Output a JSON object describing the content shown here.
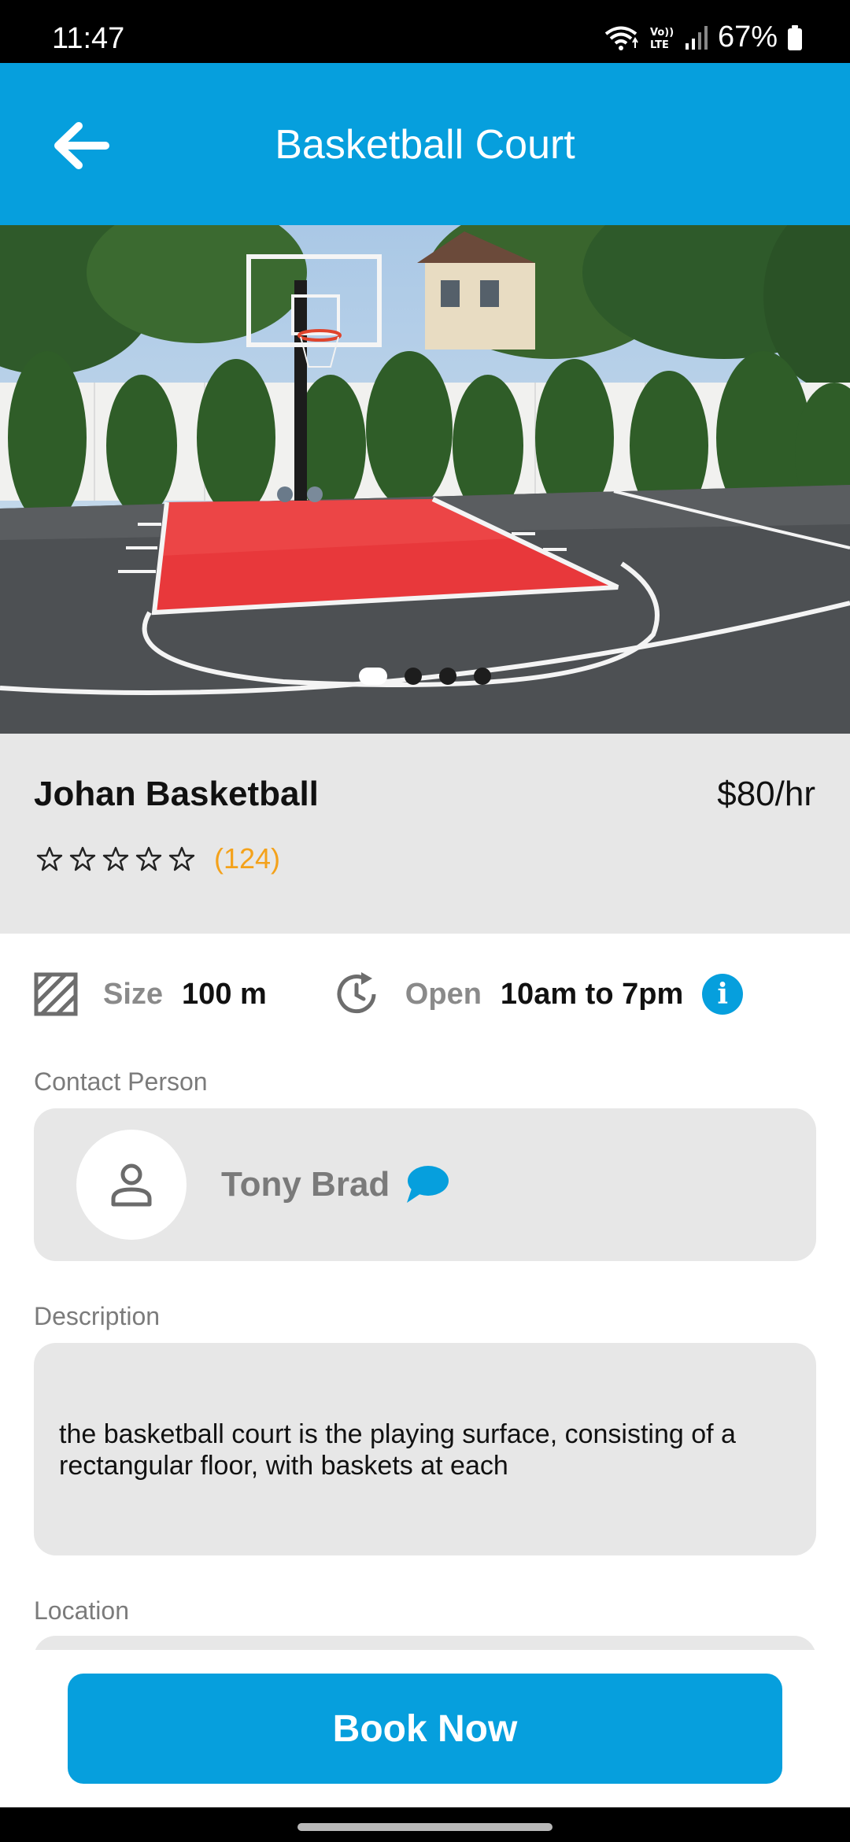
{
  "status_bar": {
    "time": "11:47",
    "battery": "67%",
    "icons": [
      "wifi-icon",
      "volte-icon",
      "signal-icon",
      "battery-icon"
    ]
  },
  "app_bar": {
    "title": "Basketball Court",
    "back_icon": "arrow-left-icon"
  },
  "carousel": {
    "image_subject": "outdoor basketball half court with red key and hoop",
    "page_count": 4,
    "active_index": 0
  },
  "venue": {
    "name": "Johan Basketball",
    "price": "$80/hr",
    "rating": 0,
    "rating_max": 5,
    "review_count": "(124)"
  },
  "details": {
    "size_label": "Size",
    "size_value": "100 m",
    "open_label": "Open",
    "open_value": "10am to 7pm"
  },
  "contact": {
    "section_label": "Contact Person",
    "name": "Tony Brad"
  },
  "description": {
    "section_label": "Description",
    "text": "the basketball court is the playing surface, consisting of a rectangular floor, with baskets at each"
  },
  "location": {
    "section_label": "Location"
  },
  "actions": {
    "book_label": "Book Now"
  },
  "colors": {
    "primary": "#069fdd",
    "review_count": "#f4a21b",
    "panel_gray": "#e7e7e7"
  }
}
